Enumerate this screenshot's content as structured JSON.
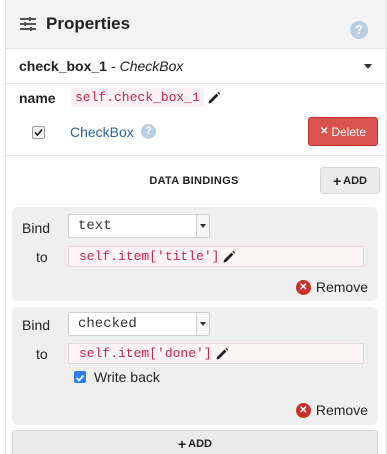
{
  "header": {
    "title": "Properties",
    "help": "?"
  },
  "component": {
    "name": "check_box_1",
    "separator": "-",
    "type": "CheckBox"
  },
  "name_field": {
    "label": "name",
    "value": "self.check_box_1"
  },
  "checkbox_row": {
    "link_text": "CheckBox",
    "help": "?",
    "delete_label": "Delete",
    "checked": true
  },
  "data_bindings": {
    "title": "DATA BINDINGS",
    "add_label": "ADD",
    "bindings": [
      {
        "bind_label": "Bind",
        "bind_value": "text",
        "to_label": "to",
        "to_value": "self.item['title']",
        "remove_label": "Remove"
      },
      {
        "bind_label": "Bind",
        "bind_value": "checked",
        "to_label": "to",
        "to_value": "self.item['done']",
        "write_back_label": "Write back",
        "write_back_checked": true,
        "remove_label": "Remove"
      }
    ],
    "add_bottom_label": "ADD"
  }
}
